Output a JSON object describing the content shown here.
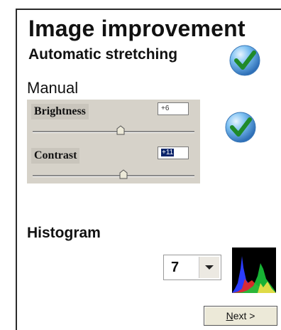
{
  "header": {
    "title": "Image improvement",
    "automatic_label": "Automatic stretching"
  },
  "manual": {
    "label": "Manual",
    "brightness": {
      "label": "Brightness",
      "value": "+6",
      "slider_fraction": 0.55
    },
    "contrast": {
      "label": "Contrast",
      "value": "+11",
      "slider_fraction": 0.57
    }
  },
  "histogram": {
    "label": "Histogram",
    "selected_value": "7"
  },
  "footer": {
    "next_label_underlined": "N",
    "next_label_rest": "ext >"
  },
  "icons": {
    "automatic_check": "checkmark-icon",
    "manual_check": "checkmark-icon",
    "dropdown": "chevron-down-icon",
    "histogram_preview": "histogram-icon"
  },
  "colors": {
    "check_blue": "#4aa0e6",
    "check_green": "#1f8a2a",
    "panel": "#d6d2c9",
    "selection": "#0a246a"
  }
}
